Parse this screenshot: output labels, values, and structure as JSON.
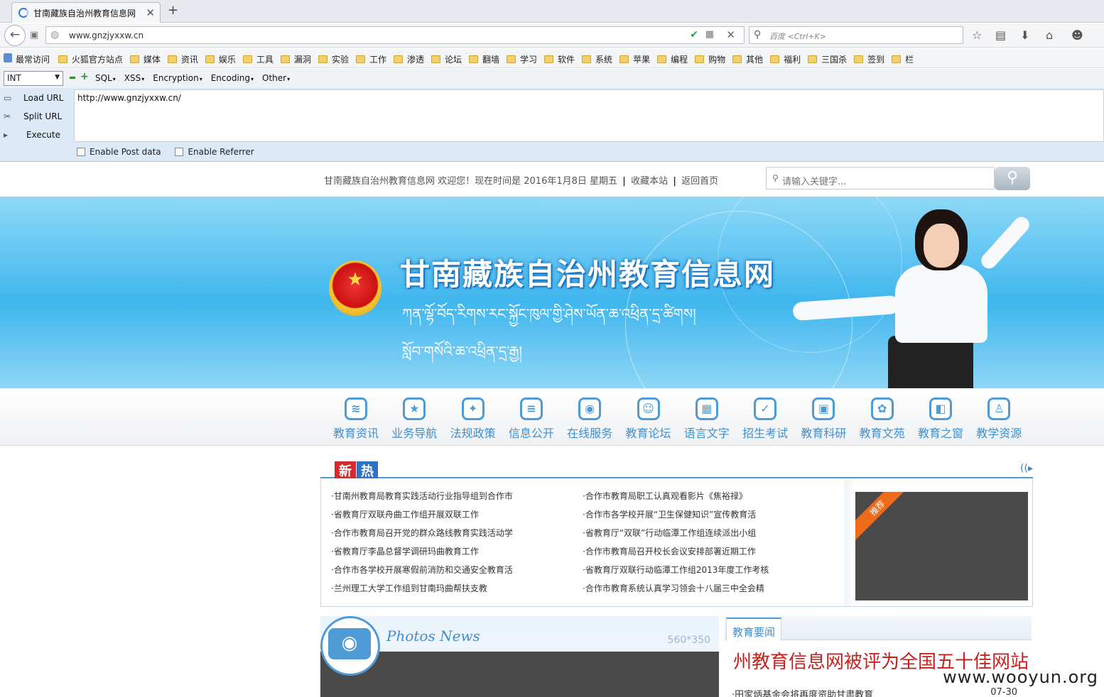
{
  "browser": {
    "tab_title": "甘南藏族自治州教育信息网",
    "url": "www.gnzjyxxw.cn",
    "search_placeholder": "百度 <Ctrl+K>"
  },
  "bookmarks": {
    "first": "最常访问",
    "items": [
      "火狐官方站点",
      "媒体",
      "资讯",
      "娱乐",
      "工具",
      "漏洞",
      "实验",
      "工作",
      "渗透",
      "论坛",
      "翻墙",
      "学习",
      "软件",
      "系统",
      "苹果",
      "编程",
      "购物",
      "其他",
      "福利",
      "三国杀",
      "签到",
      "栏"
    ]
  },
  "hackbar": {
    "select_value": "INT",
    "menus": [
      "SQL",
      "XSS",
      "Encryption",
      "Encoding",
      "Other"
    ],
    "load_url": "Load URL",
    "split_url": "Split URL",
    "execute": "Execute",
    "textarea": "http://www.gnzjyxxw.cn/",
    "enable_post": "Enable Post data",
    "enable_referrer": "Enable Referrer"
  },
  "site": {
    "welcome": "甘南藏族自治州教育信息网  欢迎您！现在时间是 2016年1月8日 星期五",
    "fav": "收藏本站",
    "home": "返回首页",
    "search_placeholder": "请输入关键字...",
    "banner_title": "甘南藏族自治州教育信息网",
    "banner_tibetan_1": "ཀན་ལྷོ་བོད་རིགས་རང་སྐྱོང་ཁུལ་གྱི་ཤེས་ཡོན་ཆ་འཕྲིན་དྲ་ཚིགས།",
    "banner_tibetan_2": "སློབ་གསོའི་ཆ་འཕྲིན་དྲ་རྒྱ།"
  },
  "nav": [
    {
      "label": "教育资讯",
      "icon": "rss-icon",
      "glyph": "≋"
    },
    {
      "label": "业务导航",
      "icon": "star-icon",
      "glyph": "★"
    },
    {
      "label": "法规政策",
      "icon": "book-icon",
      "glyph": "✦"
    },
    {
      "label": "信息公开",
      "icon": "list-icon",
      "glyph": "≡"
    },
    {
      "label": "在线服务",
      "icon": "wifi-icon",
      "glyph": "◉"
    },
    {
      "label": "教育论坛",
      "icon": "people-icon",
      "glyph": "☺"
    },
    {
      "label": "语言文字",
      "icon": "calendar-icon",
      "glyph": "▦"
    },
    {
      "label": "招生考试",
      "icon": "check-icon",
      "glyph": "✓"
    },
    {
      "label": "教育科研",
      "icon": "briefcase-icon",
      "glyph": "▣"
    },
    {
      "label": "教育文苑",
      "icon": "butterfly-icon",
      "glyph": "✿"
    },
    {
      "label": "教育之窗",
      "icon": "window-icon",
      "glyph": "◧"
    },
    {
      "label": "教学资源",
      "icon": "user-icon",
      "glyph": "♙"
    }
  ],
  "news": {
    "tag_new": "新",
    "tag_hot": "热",
    "col_a": [
      "·甘南州教育局教育实践活动行业指导组到合作市",
      "·省教育厅双联舟曲工作组开展双联工作",
      "·合作市教育局召开党的群众路线教育实践活动学",
      "·省教育厅李晶总督学调研玛曲教育工作",
      "·合作市各学校开展寒假前消防和交通安全教育活",
      "·兰州理工大学工作组到甘南玛曲帮扶支教"
    ],
    "col_b": [
      "·合作市教育局职工认真观看影片《焦裕禄》",
      "·合作市各学校开展“卫生保健知识”宣传教育活",
      "·省教育厅“双联”行动临潭工作组连续派出小组",
      "·合作市教育局召开校长会议安排部署近期工作",
      "·省教育厅双联行动临潭工作组2013年度工作考核",
      "·合作市教育系统认真学习领会十八届三中全会精"
    ],
    "recommend": "推荐"
  },
  "photos": {
    "title": "Photos News",
    "size": "560*350"
  },
  "edu": {
    "tab": "教育要闻",
    "headline": "州教育信息网被评为全国五十佳网站",
    "item": "·田家炳基金会将再度资助甘肃教育",
    "date": "07-30"
  },
  "watermark": "www.wooyun.org"
}
